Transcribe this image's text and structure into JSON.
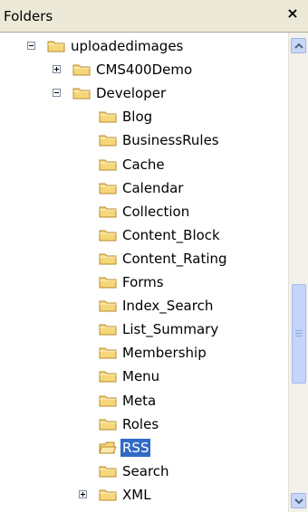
{
  "header": {
    "title": "Folders",
    "close_glyph": "×"
  },
  "tree": [
    {
      "label": "uploadedimages",
      "level": 0,
      "expander": "minus",
      "icon": "folder-icon"
    },
    {
      "label": "CMS400Demo",
      "level": 1,
      "expander": "plus",
      "icon": "folder-icon"
    },
    {
      "label": "Developer",
      "level": 1,
      "expander": "minus",
      "icon": "folder-icon"
    },
    {
      "label": "Blog",
      "level": 2,
      "expander": "none",
      "icon": "folder-icon"
    },
    {
      "label": "BusinessRules",
      "level": 2,
      "expander": "none",
      "icon": "folder-icon"
    },
    {
      "label": "Cache",
      "level": 2,
      "expander": "none",
      "icon": "folder-icon"
    },
    {
      "label": "Calendar",
      "level": 2,
      "expander": "none",
      "icon": "folder-icon"
    },
    {
      "label": "Collection",
      "level": 2,
      "expander": "none",
      "icon": "folder-icon"
    },
    {
      "label": "Content_Block",
      "level": 2,
      "expander": "none",
      "icon": "folder-icon"
    },
    {
      "label": "Content_Rating",
      "level": 2,
      "expander": "none",
      "icon": "folder-icon"
    },
    {
      "label": "Forms",
      "level": 2,
      "expander": "none",
      "icon": "folder-icon"
    },
    {
      "label": "Index_Search",
      "level": 2,
      "expander": "none",
      "icon": "folder-icon"
    },
    {
      "label": "List_Summary",
      "level": 2,
      "expander": "none",
      "icon": "folder-icon"
    },
    {
      "label": "Membership",
      "level": 2,
      "expander": "none",
      "icon": "folder-icon"
    },
    {
      "label": "Menu",
      "level": 2,
      "expander": "none",
      "icon": "folder-icon"
    },
    {
      "label": "Meta",
      "level": 2,
      "expander": "none",
      "icon": "folder-icon"
    },
    {
      "label": "Roles",
      "level": 2,
      "expander": "none",
      "icon": "folder-icon"
    },
    {
      "label": "RSS",
      "level": 2,
      "expander": "none",
      "icon": "folder-open-icon",
      "selected": true
    },
    {
      "label": "Search",
      "level": 2,
      "expander": "none",
      "icon": "folder-icon"
    },
    {
      "label": "XML",
      "level": 1.5,
      "expander": "plus",
      "icon": "folder-icon"
    }
  ],
  "scrollbar": {
    "position_fraction": 0.62
  },
  "colors": {
    "selected_bg": "#316ac5",
    "folder_fill": "#f5d77a",
    "folder_stroke": "#b8892c"
  }
}
